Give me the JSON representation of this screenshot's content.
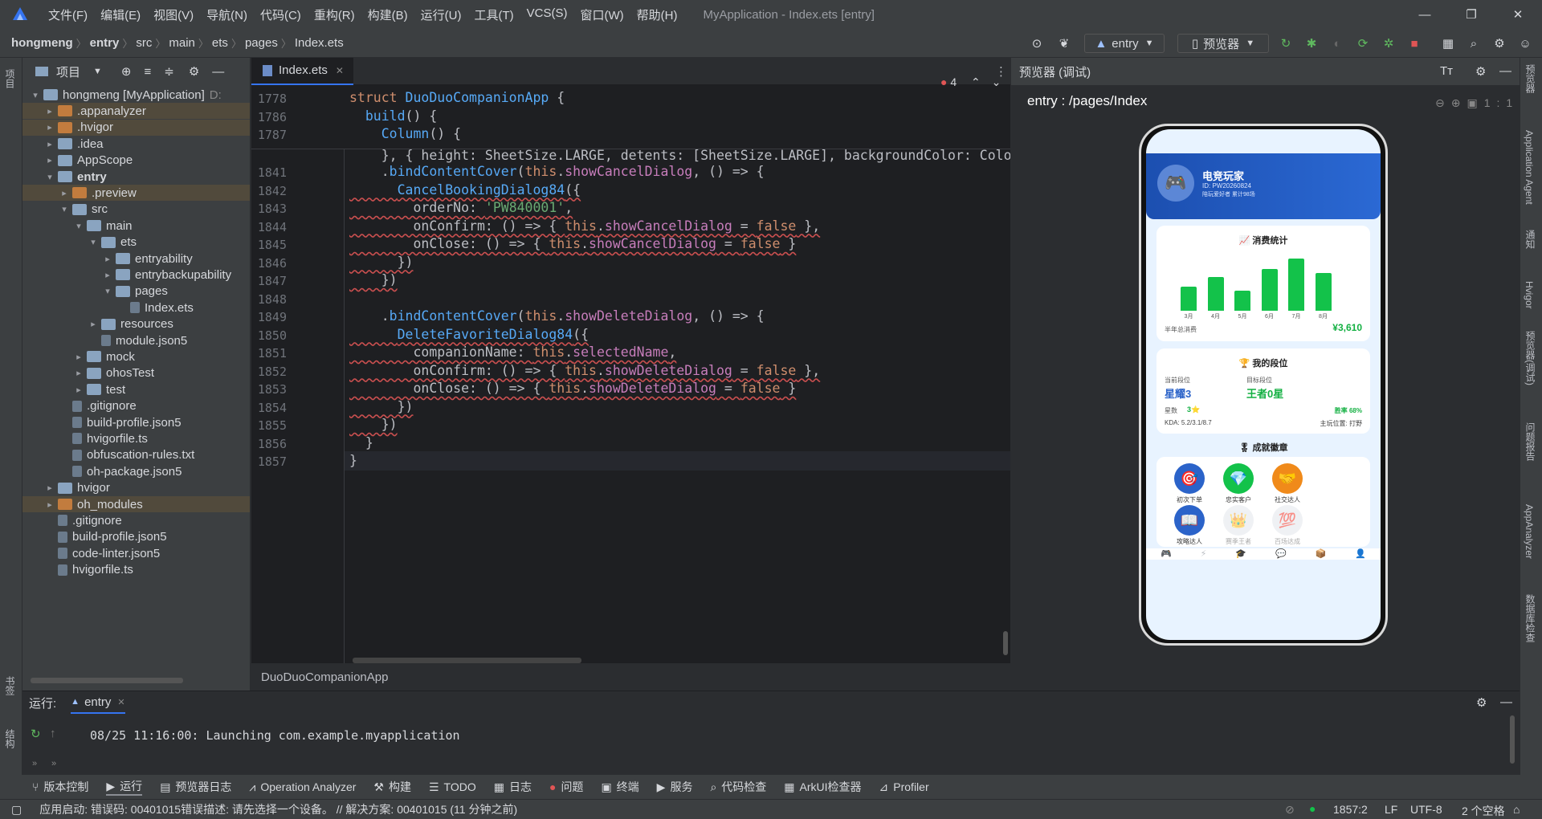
{
  "window": {
    "title": "MyApplication - Index.ets [entry]",
    "menu": [
      "文件(F)",
      "编辑(E)",
      "视图(V)",
      "导航(N)",
      "代码(C)",
      "重构(R)",
      "构建(B)",
      "运行(U)",
      "工具(T)",
      "VCS(S)",
      "窗口(W)",
      "帮助(H)"
    ]
  },
  "breadcrumb": [
    "hongmeng",
    "entry",
    "src",
    "main",
    "ets",
    "pages",
    "Index.ets"
  ],
  "toolbar": {
    "run_config": "entry",
    "device": "预览器"
  },
  "project": {
    "header": "项目",
    "tree": [
      {
        "label": "hongmeng [MyApplication]",
        "suffix": "D:",
        "depth": 0,
        "arrow": "▾",
        "icon": "fold",
        "hl": false
      },
      {
        "label": ".appanalyzer",
        "depth": 1,
        "arrow": "▸",
        "icon": "foldo",
        "hl": true
      },
      {
        "label": ".hvigor",
        "depth": 1,
        "arrow": "▸",
        "icon": "foldo",
        "hl": true
      },
      {
        "label": ".idea",
        "depth": 1,
        "arrow": "▸",
        "icon": "fold",
        "hl": false
      },
      {
        "label": "AppScope",
        "depth": 1,
        "arrow": "▸",
        "icon": "fold",
        "hl": false
      },
      {
        "label": "entry",
        "depth": 1,
        "arrow": "▾",
        "icon": "fold",
        "hl": false,
        "bold": true
      },
      {
        "label": ".preview",
        "depth": 2,
        "arrow": "▸",
        "icon": "foldo",
        "hl": true
      },
      {
        "label": "src",
        "depth": 2,
        "arrow": "▾",
        "icon": "fold",
        "hl": false
      },
      {
        "label": "main",
        "depth": 3,
        "arrow": "▾",
        "icon": "fold",
        "hl": false
      },
      {
        "label": "ets",
        "depth": 4,
        "arrow": "▾",
        "icon": "fold",
        "hl": false
      },
      {
        "label": "entryability",
        "depth": 5,
        "arrow": "▸",
        "icon": "fold",
        "hl": false
      },
      {
        "label": "entrybackupability",
        "depth": 5,
        "arrow": "▸",
        "icon": "fold",
        "hl": false
      },
      {
        "label": "pages",
        "depth": 5,
        "arrow": "▾",
        "icon": "fold",
        "hl": false
      },
      {
        "label": "Index.ets",
        "depth": 6,
        "arrow": "",
        "icon": "file",
        "hl": false
      },
      {
        "label": "resources",
        "depth": 4,
        "arrow": "▸",
        "icon": "fold",
        "hl": false
      },
      {
        "label": "module.json5",
        "depth": 4,
        "arrow": "",
        "icon": "file",
        "hl": false
      },
      {
        "label": "mock",
        "depth": 3,
        "arrow": "▸",
        "icon": "fold",
        "hl": false
      },
      {
        "label": "ohosTest",
        "depth": 3,
        "arrow": "▸",
        "icon": "fold",
        "hl": false
      },
      {
        "label": "test",
        "depth": 3,
        "arrow": "▸",
        "icon": "fold",
        "hl": false
      },
      {
        "label": ".gitignore",
        "depth": 2,
        "arrow": "",
        "icon": "file",
        "hl": false
      },
      {
        "label": "build-profile.json5",
        "depth": 2,
        "arrow": "",
        "icon": "file",
        "hl": false
      },
      {
        "label": "hvigorfile.ts",
        "depth": 2,
        "arrow": "",
        "icon": "file",
        "hl": false
      },
      {
        "label": "obfuscation-rules.txt",
        "depth": 2,
        "arrow": "",
        "icon": "file",
        "hl": false
      },
      {
        "label": "oh-package.json5",
        "depth": 2,
        "arrow": "",
        "icon": "file",
        "hl": false
      },
      {
        "label": "hvigor",
        "depth": 1,
        "arrow": "▸",
        "icon": "fold",
        "hl": false
      },
      {
        "label": "oh_modules",
        "depth": 1,
        "arrow": "▸",
        "icon": "foldo",
        "hl": true
      },
      {
        "label": ".gitignore",
        "depth": 1,
        "arrow": "",
        "icon": "file",
        "hl": false
      },
      {
        "label": "build-profile.json5",
        "depth": 1,
        "arrow": "",
        "icon": "file",
        "hl": false
      },
      {
        "label": "code-linter.json5",
        "depth": 1,
        "arrow": "",
        "icon": "file",
        "hl": false
      },
      {
        "label": "hvigorfile.ts",
        "depth": 1,
        "arrow": "",
        "icon": "file",
        "hl": false
      }
    ]
  },
  "editor": {
    "tab": "Index.ets",
    "error_count": "4",
    "footer": "DuoDuoCompanionApp",
    "sticky": [
      {
        "ln": "1778",
        "code": "struct DuoDuoCompanionApp {"
      },
      {
        "ln": "1786",
        "code": "  build() {"
      },
      {
        "ln": "1787",
        "code": "    Column() {"
      }
    ],
    "partial": "    }, { height: SheetSize.LARGE, detents: [SheetSize.LARGE], backgroundColor: Colo",
    "lines": [
      {
        "ln": "1841",
        "code": "    .bindContentCover(this.showCancelDialog, () => {"
      },
      {
        "ln": "1842",
        "code": "      CancelBookingDialog84({"
      },
      {
        "ln": "1843",
        "code": "        orderNo: 'PW840001',"
      },
      {
        "ln": "1844",
        "code": "        onConfirm: () => { this.showCancelDialog = false },"
      },
      {
        "ln": "1845",
        "code": "        onClose: () => { this.showCancelDialog = false }"
      },
      {
        "ln": "1846",
        "code": "      })"
      },
      {
        "ln": "1847",
        "code": "    })"
      },
      {
        "ln": "1848",
        "code": ""
      },
      {
        "ln": "1849",
        "code": "    .bindContentCover(this.showDeleteDialog, () => {"
      },
      {
        "ln": "1850",
        "code": "      DeleteFavoriteDialog84({"
      },
      {
        "ln": "1851",
        "code": "        companionName: this.selectedName,"
      },
      {
        "ln": "1852",
        "code": "        onConfirm: () => { this.showDeleteDialog = false },"
      },
      {
        "ln": "1853",
        "code": "        onClose: () => { this.showDeleteDialog = false }"
      },
      {
        "ln": "1854",
        "code": "      })"
      },
      {
        "ln": "1855",
        "code": "    })"
      },
      {
        "ln": "1856",
        "code": "  }"
      },
      {
        "ln": "1857",
        "code": "}"
      }
    ]
  },
  "preview": {
    "header": "预览器 (调试)",
    "route": "entry : /pages/Index",
    "app": {
      "username": "电竞玩家",
      "user_id": "ID: PW20260824",
      "user_sub": "陪玩爱好者  累计98场",
      "stats_title": "📈 消费统计",
      "months": [
        "3月",
        "4月",
        "5月",
        "6月",
        "7月",
        "8月"
      ],
      "month_values": [
        42,
        58,
        35,
        72,
        90,
        65
      ],
      "total_label": "半年总消费",
      "total_value": "¥3,610",
      "rank_title": "🏆 我的段位",
      "cur_label": "当前段位",
      "cur_value": "星耀3",
      "target_label": "目标段位",
      "target_value": "王者0星",
      "stars_label": "星数",
      "stars_value": "3⭐",
      "winrate": "胜率 68%",
      "kda": "KDA: 5.2/3.1/8.7",
      "position": "主玩位置: 打野",
      "badges_title": "🎖 成就徽章",
      "badges": [
        {
          "label": "初次下单",
          "icon": "🎯",
          "color": "#2b63c9"
        },
        {
          "label": "忠实客户",
          "icon": "💎",
          "color": "#13c24a"
        },
        {
          "label": "社交达人",
          "icon": "🤝",
          "color": "#f08a1a"
        },
        {
          "label": "攻略达人",
          "icon": "📖",
          "color": "#2b63c9"
        },
        {
          "label": "赛季王者",
          "icon": "👑",
          "color": "#e6e9ee"
        },
        {
          "label": "百场达成",
          "icon": "💯",
          "color": "#e6e9ee"
        }
      ],
      "bottom_icons": [
        "🎮",
        "⚡",
        "🎓",
        "💬",
        "📦",
        "👤"
      ]
    }
  },
  "run": {
    "label": "运行:",
    "tab": "entry",
    "log": "08/25 11:16:00: Launching com.example.myapplication"
  },
  "bottom_tools": [
    "版本控制",
    "运行",
    "预览器日志",
    "Operation Analyzer",
    "构建",
    "TODO",
    "日志",
    "问题",
    "终端",
    "服务",
    "代码检查",
    "ArkUI检查器",
    "Profiler"
  ],
  "status": {
    "message": "应用启动: 错误码: 00401015错误描述: 请先选择一个设备。 // 解决方案: 00401015 (11 分钟之前)",
    "position": "1857:2",
    "lf": "LF",
    "encoding": "UTF-8",
    "indent": "2 个空格"
  },
  "side_labels": {
    "left": [
      "项目",
      "书签",
      "结构"
    ],
    "right": [
      "预览器",
      "Application Agent",
      "通知",
      "Hvigor",
      "预览器(调试)",
      "问题报告",
      "AppAnalyzer",
      "数据库检查"
    ]
  }
}
